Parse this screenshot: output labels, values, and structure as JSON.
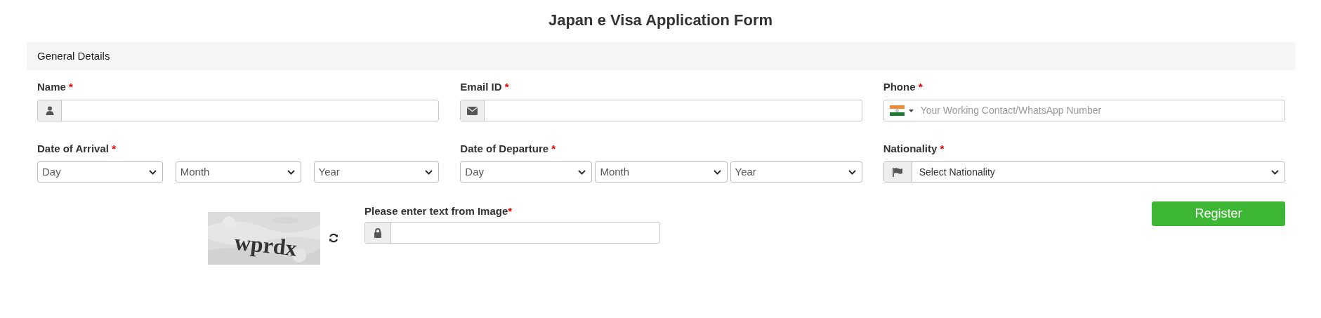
{
  "title": "Japan e Visa Application Form",
  "section": {
    "title": "General Details"
  },
  "fields": [
    {
      "kind": "text",
      "label": "Name",
      "required": "*"
    },
    {
      "kind": "text",
      "label": "Email ID",
      "required": "*"
    },
    {
      "kind": "phone",
      "label": "Phone",
      "required": "*",
      "placeholder": "Your Working Contact/WhatsApp Number"
    },
    {
      "kind": "date",
      "label": "Date of Arrival",
      "required": "*",
      "selects": [
        "Day",
        "Month",
        "Year"
      ]
    },
    {
      "kind": "date",
      "label": "Date of Departure",
      "required": "*",
      "selects": [
        "Day",
        "Month",
        "Year"
      ]
    },
    {
      "kind": "select",
      "label": "Nationality",
      "required": "*",
      "value": "Select Nationality"
    }
  ],
  "captcha": {
    "image_text": "wprdx",
    "label": "Please enter text from Image",
    "required": "*"
  },
  "register_button": "Register"
}
